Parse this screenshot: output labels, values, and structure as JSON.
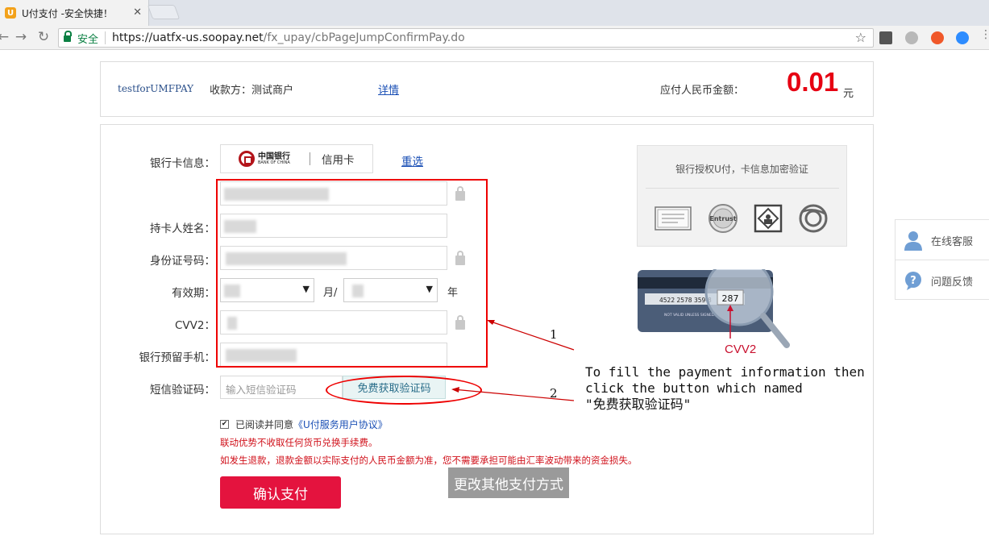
{
  "browser": {
    "tab_title": "U付支付 -安全快捷！",
    "tab_favicon": "U",
    "secure_label": "安全",
    "url_host": "https://uatfx-us.soopay.net",
    "url_path": "/fx_upay/cbPageJumpConfirmPay.do"
  },
  "header": {
    "merchant_id": "testforUMFPAY",
    "payee": "收款方：测试商户",
    "detail_link": "详情",
    "amount_label": "应付人民币金额：",
    "amount": "0.01",
    "currency": "元"
  },
  "form": {
    "bank_card_label": "银行卡信息：",
    "bank_name_cn": "中国银行",
    "bank_name_en": "BANK OF CHINA",
    "card_type": "信用卡",
    "reselect_link": "重选",
    "cardholder_label": "持卡人姓名：",
    "id_number_label": "身份证号码：",
    "expiry_label": "有效期：",
    "month_label": "月/",
    "year_label": "年",
    "cvv2_label": "CVV2：",
    "phone_label": "银行预留手机：",
    "sms_label": "短信验证码：",
    "sms_placeholder": "输入短信验证码",
    "sms_button": "免费获取验证码",
    "agree_prefix": "已阅读并同意",
    "agreement_link": "《U付服务用户协议》",
    "notice_1": "联动优势不收取任何货币兑换手续费。",
    "notice_2": "如发生退款，退款金额以实际支付的人民币金额为准，您不需要承担可能由汇率波动带来的资金损失。",
    "confirm_button": "确认支付",
    "change_method_button": "更改其他支付方式"
  },
  "security": {
    "title": "银行授权U付，卡信息加密验证",
    "seal_text": "Entrust"
  },
  "card_illustration": {
    "card_number": "4522 2578 359-8",
    "card_small_text": "NOT VALID UNLESS SIGNED",
    "cvv_digits": "287",
    "cvv_caption": "CVV2"
  },
  "side_widget": {
    "online_service": "在线客服",
    "feedback": "问题反馈"
  },
  "annotation": {
    "marker_1": "1",
    "marker_2": "2",
    "line_1": "To fill the payment information then",
    "line_2": "click the button which named",
    "line_3": "\"免费获取验证码\""
  },
  "colors": {
    "accent_red": "#e4133e",
    "amount_red": "#e60012",
    "link_blue": "#1a4fb5"
  }
}
